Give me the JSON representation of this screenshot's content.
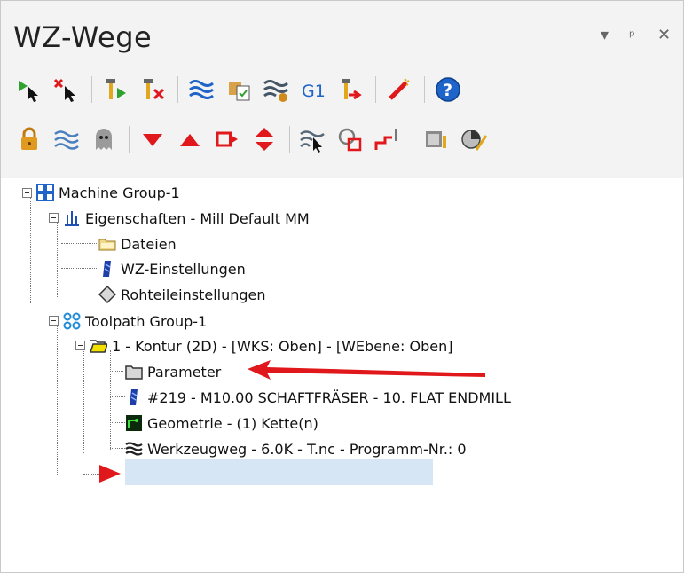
{
  "window": {
    "title": "WZ-Wege",
    "controls": {
      "dropdown": "▾",
      "pin": "ᵖ",
      "close": "✕"
    }
  },
  "toolbar": {
    "g1_label": "G1"
  },
  "tree": {
    "machine_group": "Machine Group-1",
    "properties": "Eigenschaften - Mill Default MM",
    "files": "Dateien",
    "tool_settings": "WZ-Einstellungen",
    "stock_settings": "Rohteileinstellungen",
    "toolpath_group": "Toolpath Group-1",
    "operation": "1 - Kontur (2D) - [WKS: Oben] - [WEbene: Oben]",
    "parameter": "Parameter",
    "tool": "#219 - M10.00 SCHAFTFRÄSER -     10. FLAT ENDMILL",
    "geometry": "Geometrie -  (1) Kette(n)",
    "toolpath": "Werkzeugweg - 6.0K - T.nc - Programm-Nr.: 0"
  },
  "colors": {
    "accent_red": "#e0181b",
    "selection": "#d7e6f5",
    "folder_yellow": "#f2c83c",
    "blue": "#1f64c8"
  }
}
